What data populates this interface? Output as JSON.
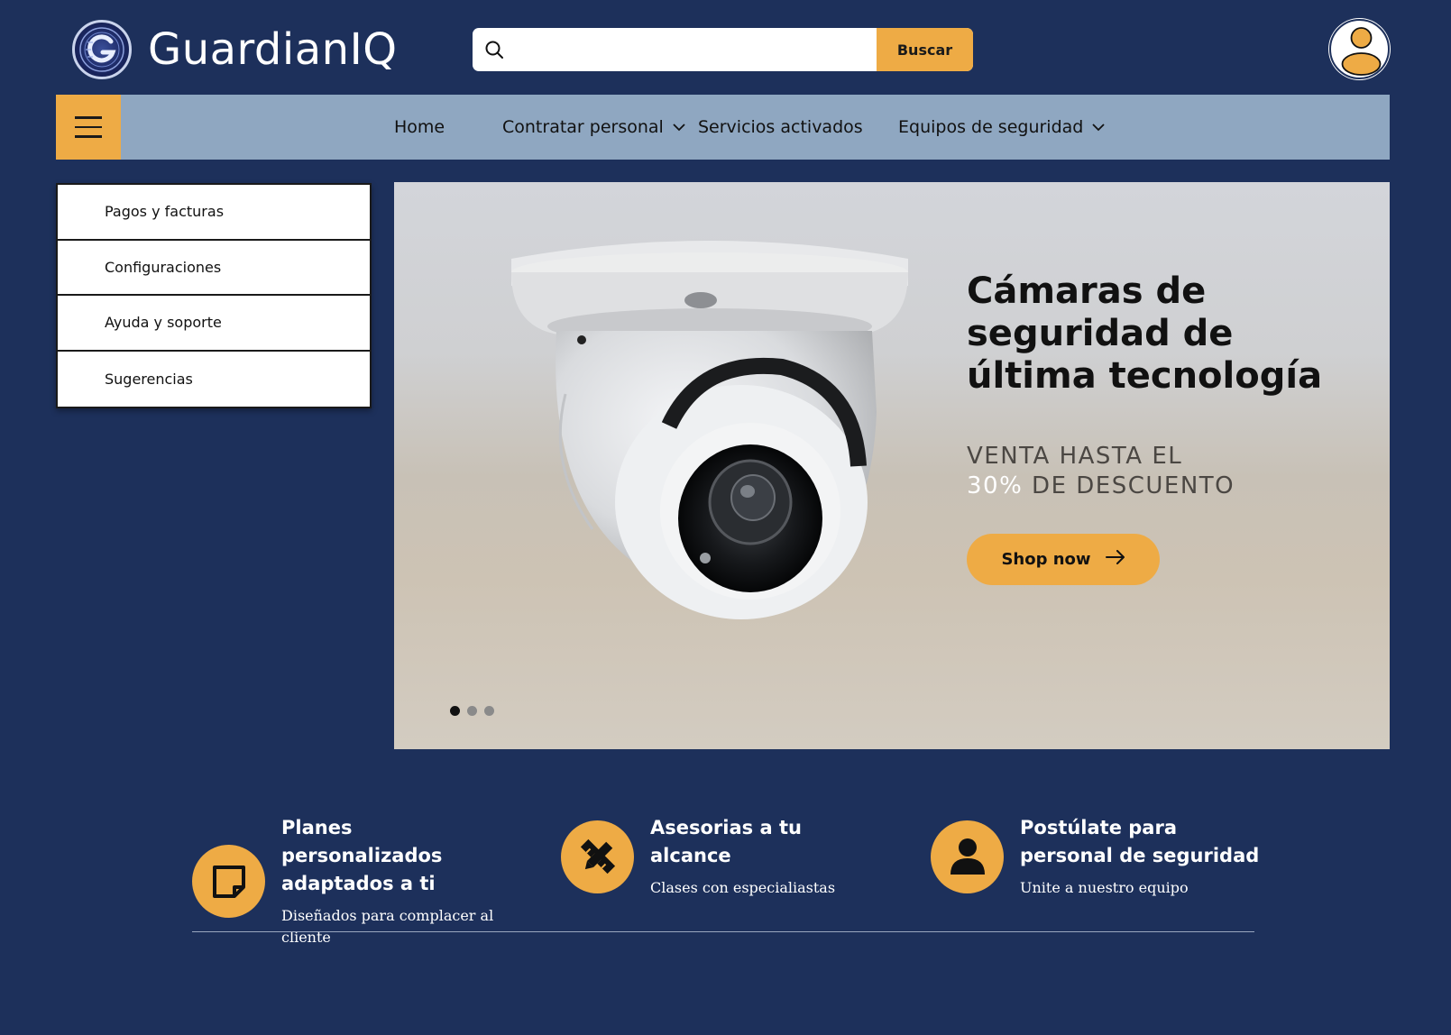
{
  "header": {
    "brand": "GuardianIQ",
    "search": {
      "placeholder": "",
      "value": "",
      "button_label": "Buscar"
    }
  },
  "nav": {
    "items": [
      {
        "label": "Home"
      },
      {
        "label": "Contratar personal"
      },
      {
        "label": "Servicios activados"
      },
      {
        "label": "Equipos de seguridad"
      }
    ]
  },
  "side_menu": {
    "items": [
      {
        "label": "Pagos y facturas"
      },
      {
        "label": "Configuraciones"
      },
      {
        "label": "Ayuda y soporte"
      },
      {
        "label": "Sugerencias"
      }
    ]
  },
  "hero": {
    "title": "Cámaras de seguridad de última tecnología",
    "subtitle_line1": "VENTA HASTA EL",
    "subtitle_pct": "30%",
    "subtitle_line2_rest": " DE DESCUENTO",
    "cta_label": "Shop now",
    "slides": 3,
    "active_slide": 1
  },
  "features": [
    {
      "icon": "note-icon",
      "title": "Planes personalizados adaptados a ti",
      "desc": "Diseñados para complacer al cliente"
    },
    {
      "icon": "pencil-ruler-icon",
      "title": "Asesorias a tu alcance",
      "desc": "Clases con especialiastas"
    },
    {
      "icon": "person-icon",
      "title": "Postúlate para personal de seguridad",
      "desc": "Unite a nuestro equipo"
    }
  ],
  "colors": {
    "background": "#1d305b",
    "accent": "#eeab45",
    "navbar": "#8fa7c1"
  }
}
